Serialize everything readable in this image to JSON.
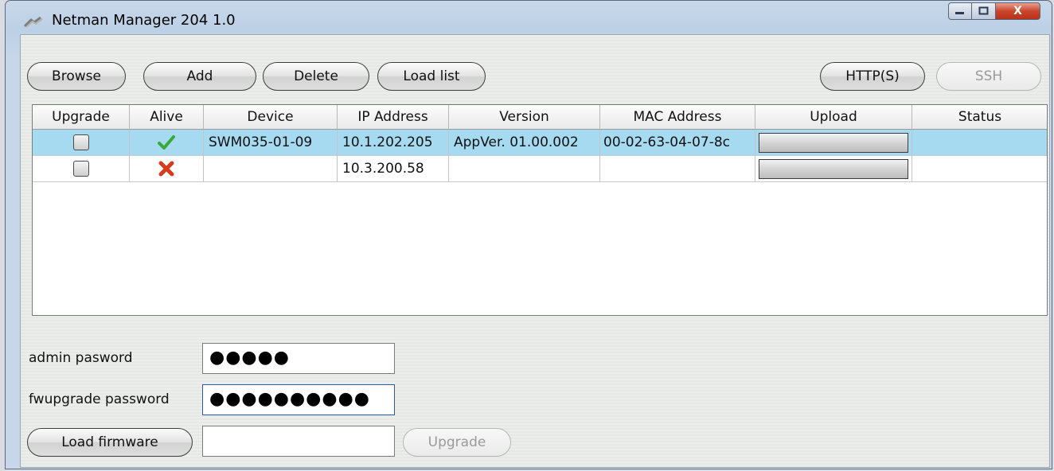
{
  "window": {
    "title": "Netman Manager 204 1.0",
    "controls": {
      "close": "X"
    }
  },
  "toolbar": {
    "browse": "Browse",
    "add": "Add",
    "delete": "Delete",
    "load_list": "Load list",
    "http": "HTTP(S)",
    "ssh": "SSH"
  },
  "table": {
    "columns": [
      "Upgrade",
      "Alive",
      "Device",
      "IP Address",
      "Version",
      "MAC Address",
      "Upload",
      "Status"
    ],
    "rows": [
      {
        "upgrade": false,
        "alive": true,
        "alive_icon": "check-icon",
        "device": "SWM035-01-09",
        "ip": "10.1.202.205",
        "version": "AppVer. 01.00.002",
        "mac": "00-02-63-04-07-8c",
        "upload_progress": 0,
        "status": "",
        "selected": true
      },
      {
        "upgrade": false,
        "alive": false,
        "alive_icon": "cross-icon",
        "device": "",
        "ip": "10.3.200.58",
        "version": "",
        "mac": "",
        "upload_progress": 0,
        "status": "",
        "selected": false
      }
    ]
  },
  "form": {
    "admin_label": "admin pasword",
    "admin_value": "●●●●●",
    "fw_label": "fwupgrade password",
    "fw_value": "●●●●●●●●●●",
    "load_firmware": "Load firmware",
    "firmware_path": "",
    "upgrade": "Upgrade"
  },
  "colors": {
    "selected_row": "#a6daf0",
    "alive_ok": "#3aa83a",
    "alive_fail": "#d9391c"
  }
}
